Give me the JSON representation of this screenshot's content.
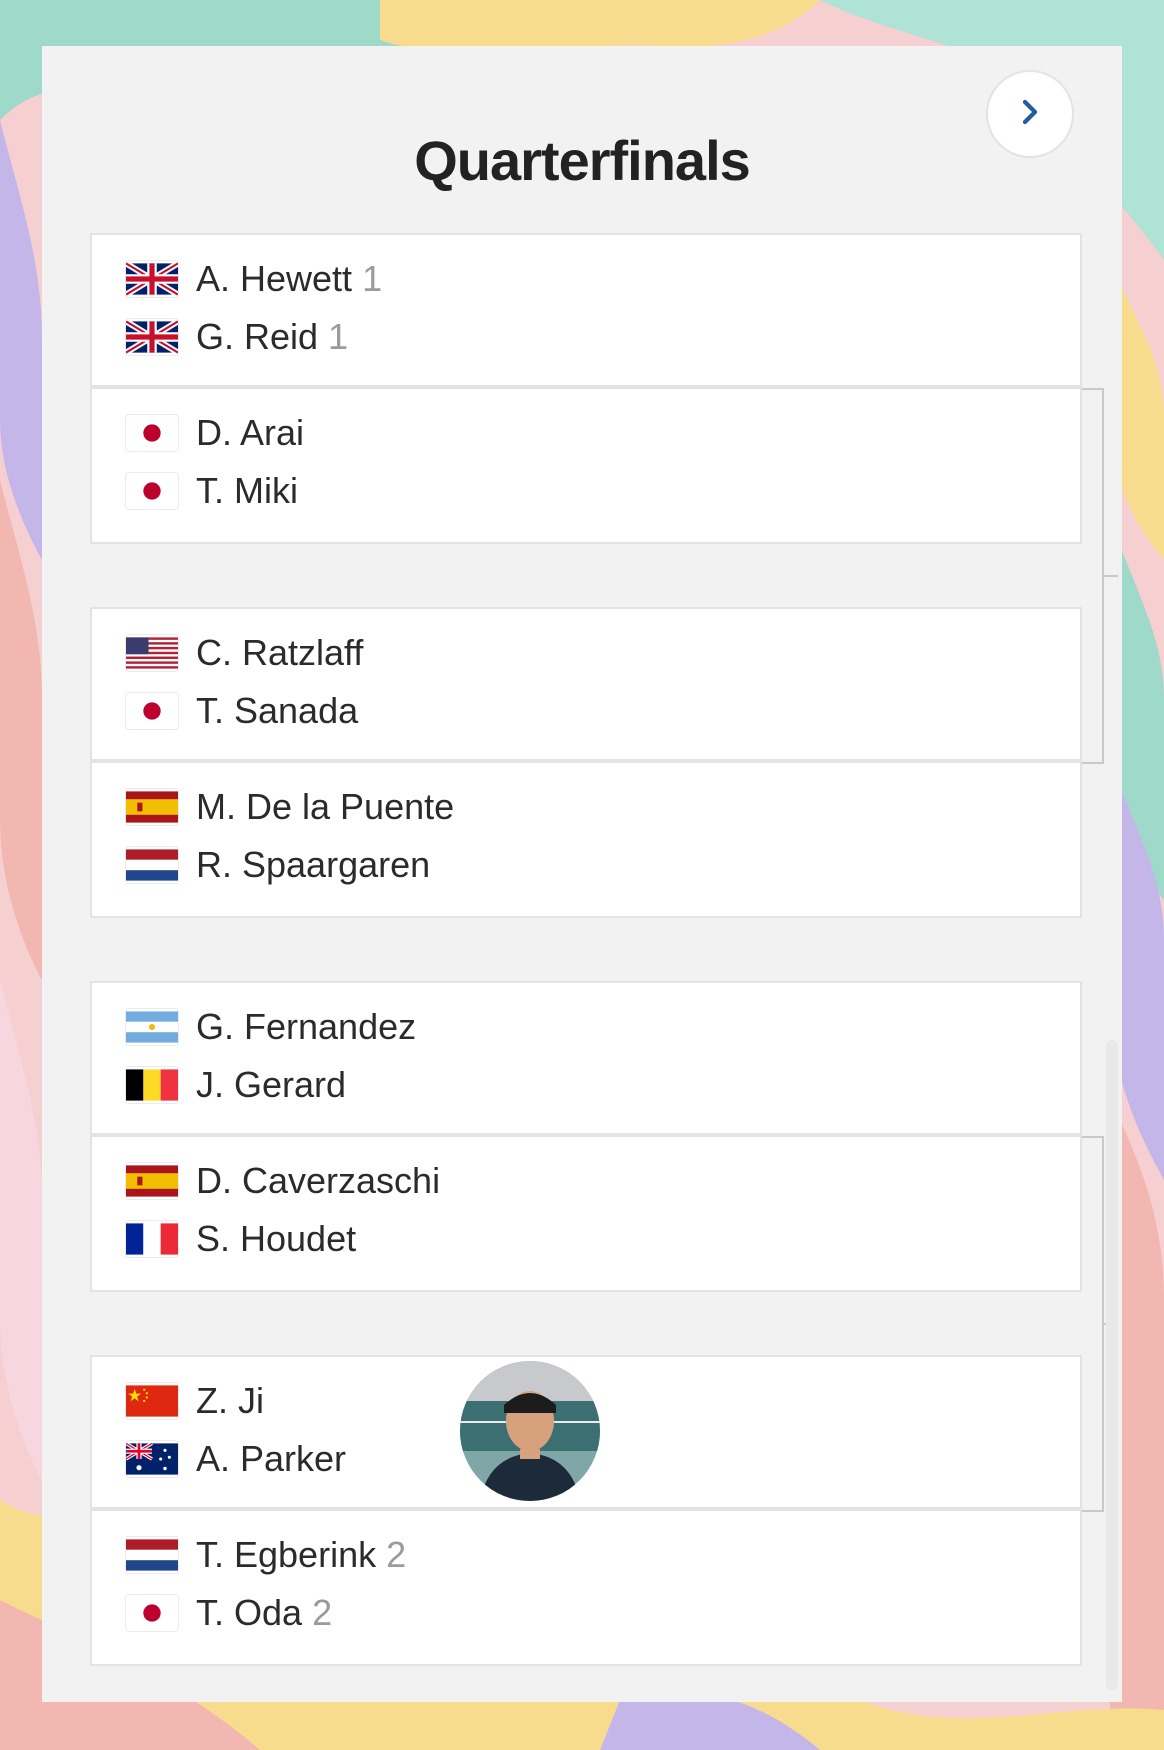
{
  "page": {
    "title": "Quarterfinals",
    "next_icon": "chevron-right-icon"
  },
  "colors": {
    "panel_bg": "#f2f2f2",
    "title": "#222222",
    "seed": "#9b9b9b",
    "accent": "#1f5fa0"
  },
  "matches": [
    {
      "players": [
        {
          "name": "A. Hewett",
          "seed": "1",
          "flag": "gb"
        },
        {
          "name": "G. Reid",
          "seed": "1",
          "flag": "gb"
        }
      ]
    },
    {
      "players": [
        {
          "name": "D. Arai",
          "seed": "",
          "flag": "jp"
        },
        {
          "name": "T. Miki",
          "seed": "",
          "flag": "jp"
        }
      ]
    },
    {
      "players": [
        {
          "name": "C. Ratzlaff",
          "seed": "",
          "flag": "us"
        },
        {
          "name": "T. Sanada",
          "seed": "",
          "flag": "jp"
        }
      ]
    },
    {
      "players": [
        {
          "name": "M. De la Puente",
          "seed": "",
          "flag": "es"
        },
        {
          "name": "R. Spaargaren",
          "seed": "",
          "flag": "nl"
        }
      ]
    },
    {
      "players": [
        {
          "name": "G. Fernandez",
          "seed": "",
          "flag": "ar"
        },
        {
          "name": "J. Gerard",
          "seed": "",
          "flag": "be"
        }
      ]
    },
    {
      "players": [
        {
          "name": "D. Caverzaschi",
          "seed": "",
          "flag": "es"
        },
        {
          "name": "S. Houdet",
          "seed": "",
          "flag": "fr"
        }
      ]
    },
    {
      "players": [
        {
          "name": "Z. Ji",
          "seed": "",
          "flag": "cn"
        },
        {
          "name": "A. Parker",
          "seed": "",
          "flag": "au"
        }
      ]
    },
    {
      "players": [
        {
          "name": "T. Egberink",
          "seed": "2",
          "flag": "nl"
        },
        {
          "name": "T. Oda",
          "seed": "2",
          "flag": "jp"
        }
      ]
    }
  ]
}
